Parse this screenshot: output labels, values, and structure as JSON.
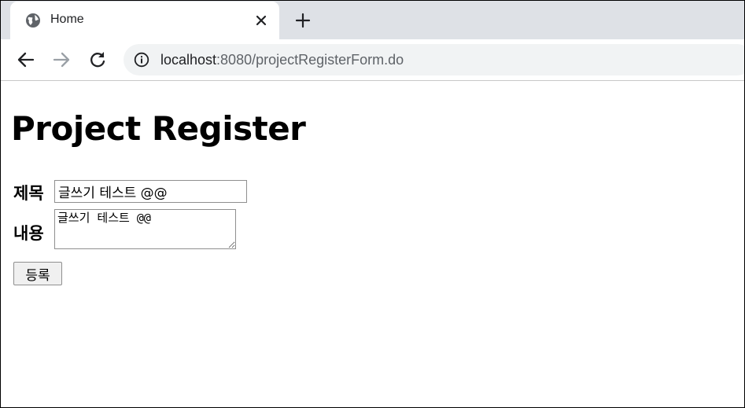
{
  "browser": {
    "tab": {
      "title": "Home",
      "icon": "globe-icon"
    },
    "toolbar": {
      "back_icon": "back-arrow-icon",
      "forward_icon": "forward-arrow-icon",
      "reload_icon": "reload-icon",
      "site_info_icon": "info-icon"
    },
    "address_bar": {
      "host": "localhost",
      "rest": ":8080/projectRegisterForm.do"
    }
  },
  "page": {
    "heading": "Project Register",
    "form": {
      "title_label": "제목",
      "title_value": "글쓰기 테스트 @@",
      "content_label": "내용",
      "content_value": "글쓰기 테스트 @@",
      "submit_label": "등록"
    }
  },
  "colors": {
    "tabstrip_bg": "#dee1e6",
    "omnibox_bg": "#f1f3f4",
    "icon_color": "#5f6368"
  }
}
